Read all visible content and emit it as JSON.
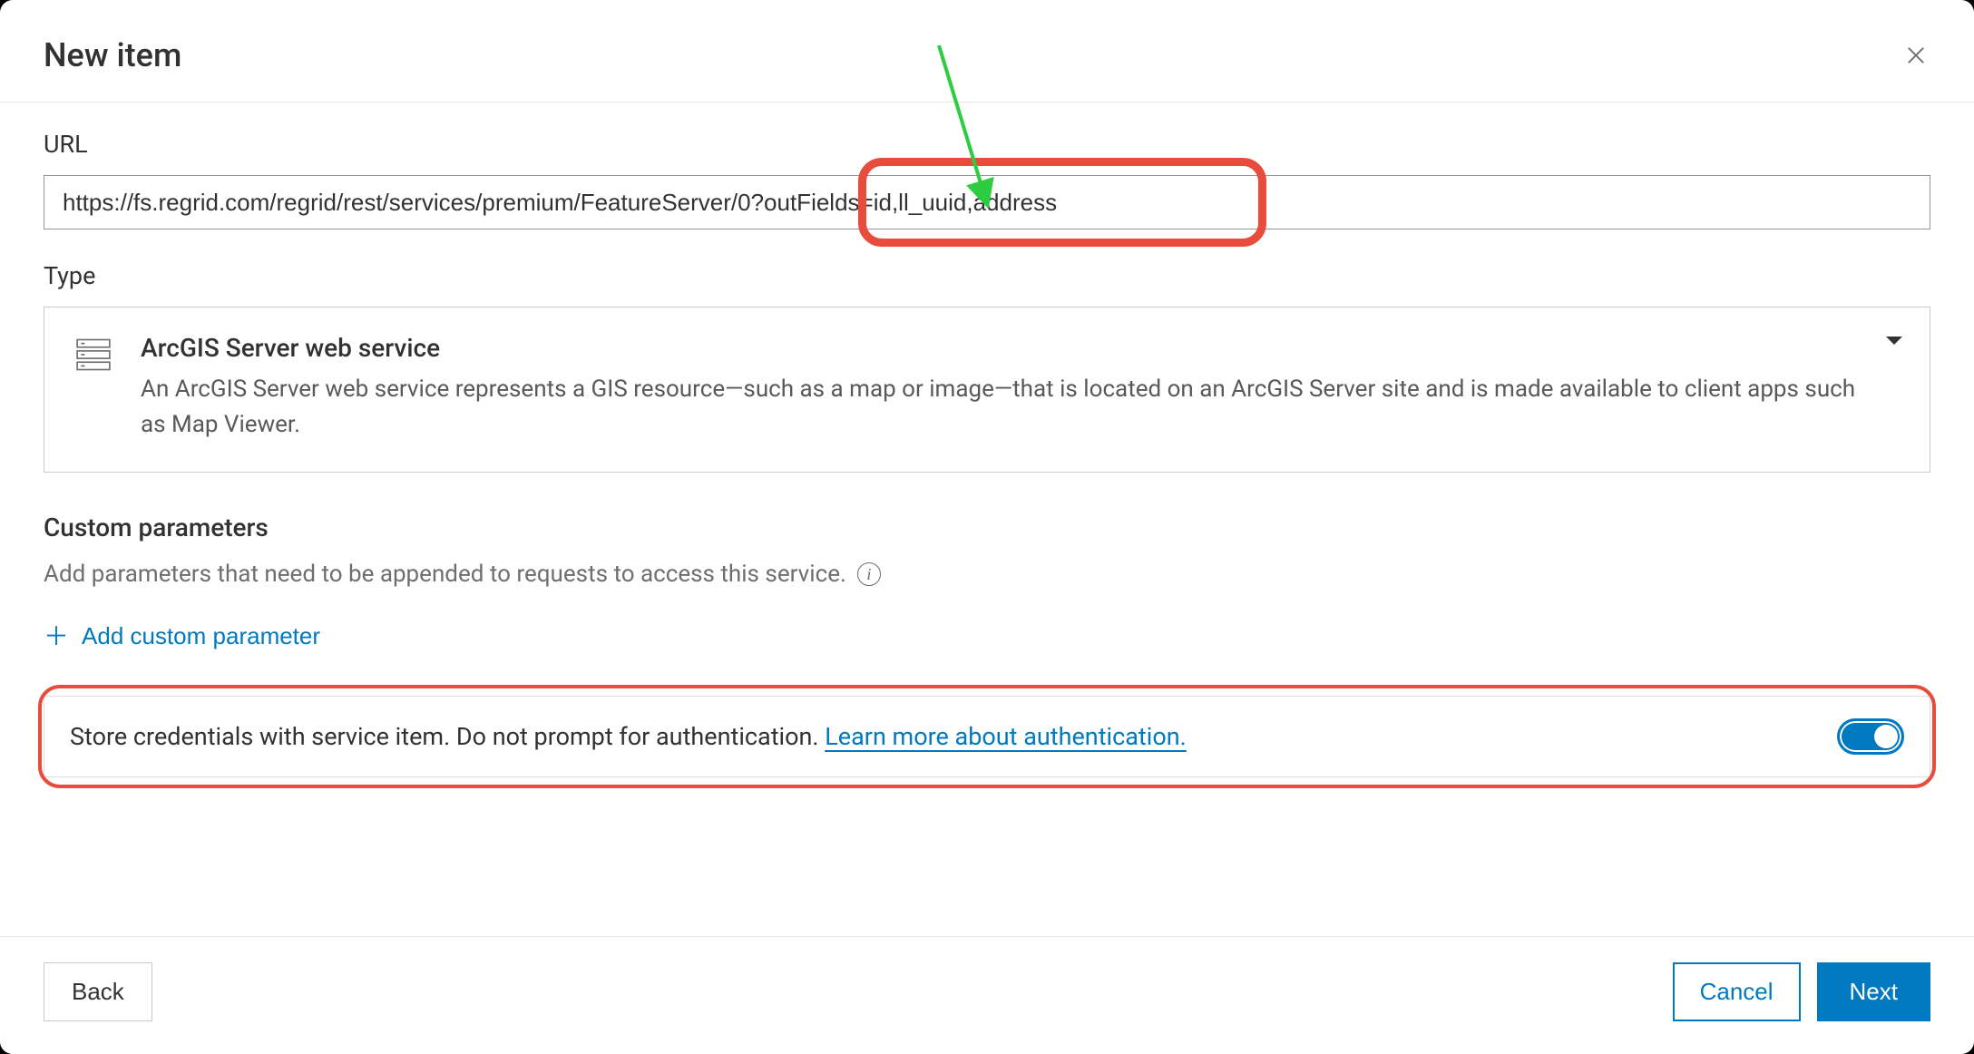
{
  "header": {
    "title": "New item"
  },
  "url": {
    "label": "URL",
    "value": "https://fs.regrid.com/regrid/rest/services/premium/FeatureServer/0?outFields=id,ll_uuid,address"
  },
  "type": {
    "label": "Type",
    "title": "ArcGIS Server web service",
    "description": "An ArcGIS Server web service represents a GIS resource—such as a map or image—that is located on an ArcGIS Server site and is made available to client apps such as Map Viewer."
  },
  "custom_params": {
    "heading": "Custom parameters",
    "help": "Add parameters that need to be appended to requests to access this service.",
    "add_label": "Add custom parameter"
  },
  "credentials": {
    "text": "Store credentials with service item. Do not prompt for authentication. ",
    "link_text": "Learn more about authentication.",
    "toggle_on": true
  },
  "footer": {
    "back": "Back",
    "cancel": "Cancel",
    "next": "Next"
  }
}
